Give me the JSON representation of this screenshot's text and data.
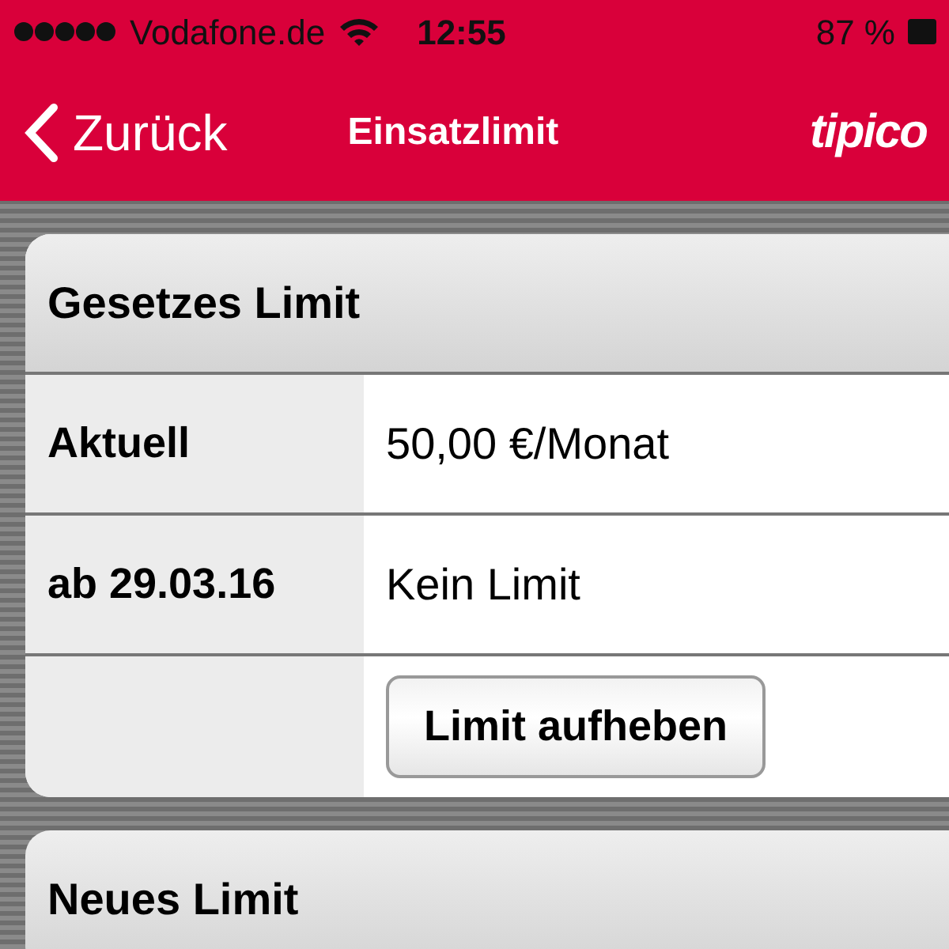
{
  "status_bar": {
    "carrier": "Vodafone.de",
    "time": "12:55",
    "battery": "87 %"
  },
  "nav_bar": {
    "back": "Zurück",
    "title": "Einsatzlimit",
    "logo": "tipico"
  },
  "sections": [
    {
      "title": "Gesetzes Limit",
      "rows": [
        {
          "kind": "value",
          "label": "Aktuell",
          "value": "50,00 €/Monat"
        },
        {
          "kind": "value",
          "label": "ab 29.03.16",
          "value": "Kein Limit"
        },
        {
          "kind": "button",
          "button": "Limit aufheben"
        }
      ]
    },
    {
      "title": "Neues Limit"
    }
  ]
}
